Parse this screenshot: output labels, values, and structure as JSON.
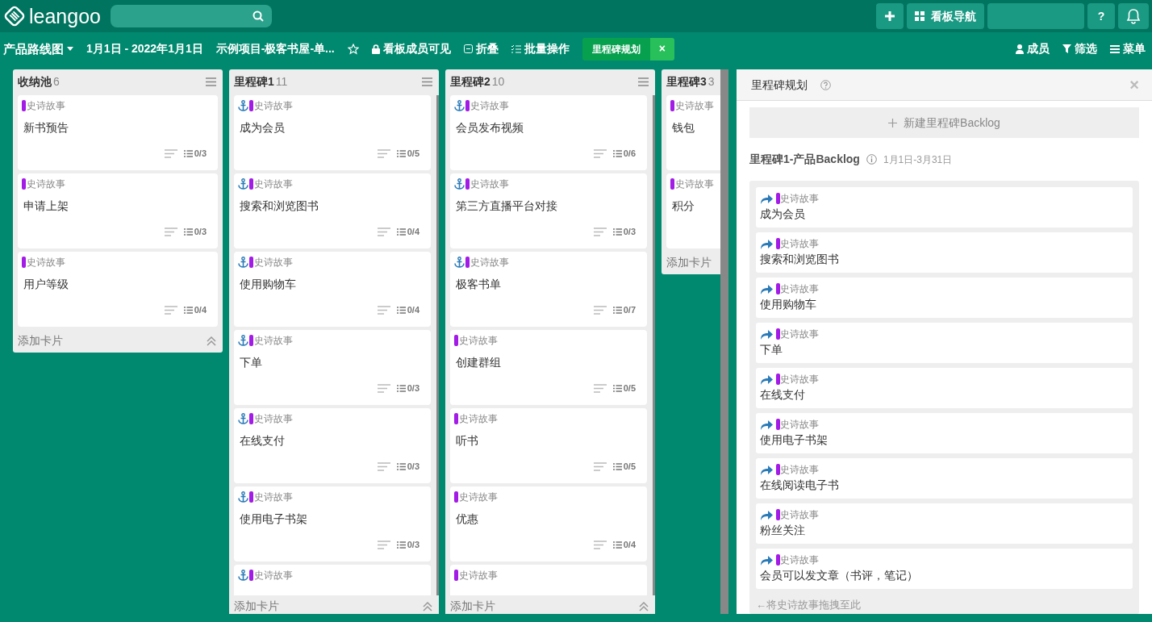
{
  "topbar": {
    "logo": "leangoo",
    "nav_label": "看板导航",
    "help": "?"
  },
  "toolbar": {
    "board_title": "产品路线图",
    "dates": "1月1日 - 2022年1月1日",
    "project": "示例项目-极客书屋-单...",
    "visibility": "看板成员可见",
    "collapse": "折叠",
    "batch": "批量操作",
    "milestone": {
      "label": "里程碑规划",
      "close": "×",
      "active": true
    },
    "members": "成员",
    "filter": "筛选",
    "menu": "菜单"
  },
  "lists": [
    {
      "title": "收纳池",
      "count": "6",
      "menu": true,
      "scrollbar": false,
      "add_label": "添加卡片",
      "cards": [
        {
          "anchored": false,
          "tag": "史诗故事",
          "title": "新书预告",
          "checklist": "0/3"
        },
        {
          "anchored": false,
          "tag": "史诗故事",
          "title": "申请上架",
          "checklist": "0/3"
        },
        {
          "anchored": false,
          "tag": "史诗故事",
          "title": "用户等级",
          "checklist": "0/4"
        }
      ]
    },
    {
      "title": "里程碑1",
      "count": "11",
      "menu": true,
      "scrollbar": true,
      "add_label": "添加卡片",
      "cards": [
        {
          "anchored": true,
          "tag": "史诗故事",
          "title": "成为会员",
          "checklist": "0/5"
        },
        {
          "anchored": true,
          "tag": "史诗故事",
          "title": "搜索和浏览图书",
          "checklist": "0/4"
        },
        {
          "anchored": true,
          "tag": "史诗故事",
          "title": "使用购物车",
          "checklist": "0/4"
        },
        {
          "anchored": true,
          "tag": "史诗故事",
          "title": "下单",
          "checklist": "0/3"
        },
        {
          "anchored": true,
          "tag": "史诗故事",
          "title": "在线支付",
          "checklist": "0/3"
        },
        {
          "anchored": true,
          "tag": "史诗故事",
          "title": "使用电子书架",
          "checklist": "0/3"
        },
        {
          "anchored": true,
          "tag": "史诗故事"
        }
      ]
    },
    {
      "title": "里程碑2",
      "count": "10",
      "menu": true,
      "scrollbar": true,
      "add_label": "添加卡片",
      "cards": [
        {
          "anchored": true,
          "tag": "史诗故事",
          "title": "会员发布视频",
          "checklist": "0/6"
        },
        {
          "anchored": true,
          "tag": "史诗故事",
          "title": "第三方直播平台对接",
          "checklist": "0/3"
        },
        {
          "anchored": true,
          "tag": "史诗故事",
          "title": "极客书单",
          "checklist": "0/7"
        },
        {
          "anchored": false,
          "tag": "史诗故事",
          "title": "创建群组",
          "checklist": "0/5"
        },
        {
          "anchored": false,
          "tag": "史诗故事",
          "title": "听书",
          "checklist": "0/5"
        },
        {
          "anchored": false,
          "tag": "史诗故事",
          "title": "优惠",
          "checklist": "0/4"
        },
        {
          "anchored": false,
          "tag": "史诗故事"
        }
      ]
    },
    {
      "title": "里程碑3",
      "count": "3",
      "add_label": "添加卡片",
      "cards": [
        {
          "anchored": false,
          "tag": "史诗故事",
          "title": "钱包"
        },
        {
          "anchored": false,
          "tag": "史诗故事",
          "title": "积分"
        }
      ]
    }
  ],
  "panel": {
    "title": "里程碑规划",
    "close": "×",
    "new_button": "新建里程碑Backlog",
    "section_title": "里程碑1-产品Backlog",
    "section_dates": "1月1日-3月31日",
    "drop_hint": "←将史诗故事拖拽至此",
    "items": [
      {
        "tag": "史诗故事",
        "title": "成为会员"
      },
      {
        "tag": "史诗故事",
        "title": "搜索和浏览图书"
      },
      {
        "tag": "史诗故事",
        "title": "使用购物车"
      },
      {
        "tag": "史诗故事",
        "title": "下单"
      },
      {
        "tag": "史诗故事",
        "title": "在线支付"
      },
      {
        "tag": "史诗故事",
        "title": "使用电子书架"
      },
      {
        "tag": "史诗故事",
        "title": "在线阅读电子书"
      },
      {
        "tag": "史诗故事",
        "title": "粉丝关注"
      },
      {
        "tag": "史诗故事",
        "title": "会员可以发文章（书评，笔记）"
      }
    ]
  }
}
